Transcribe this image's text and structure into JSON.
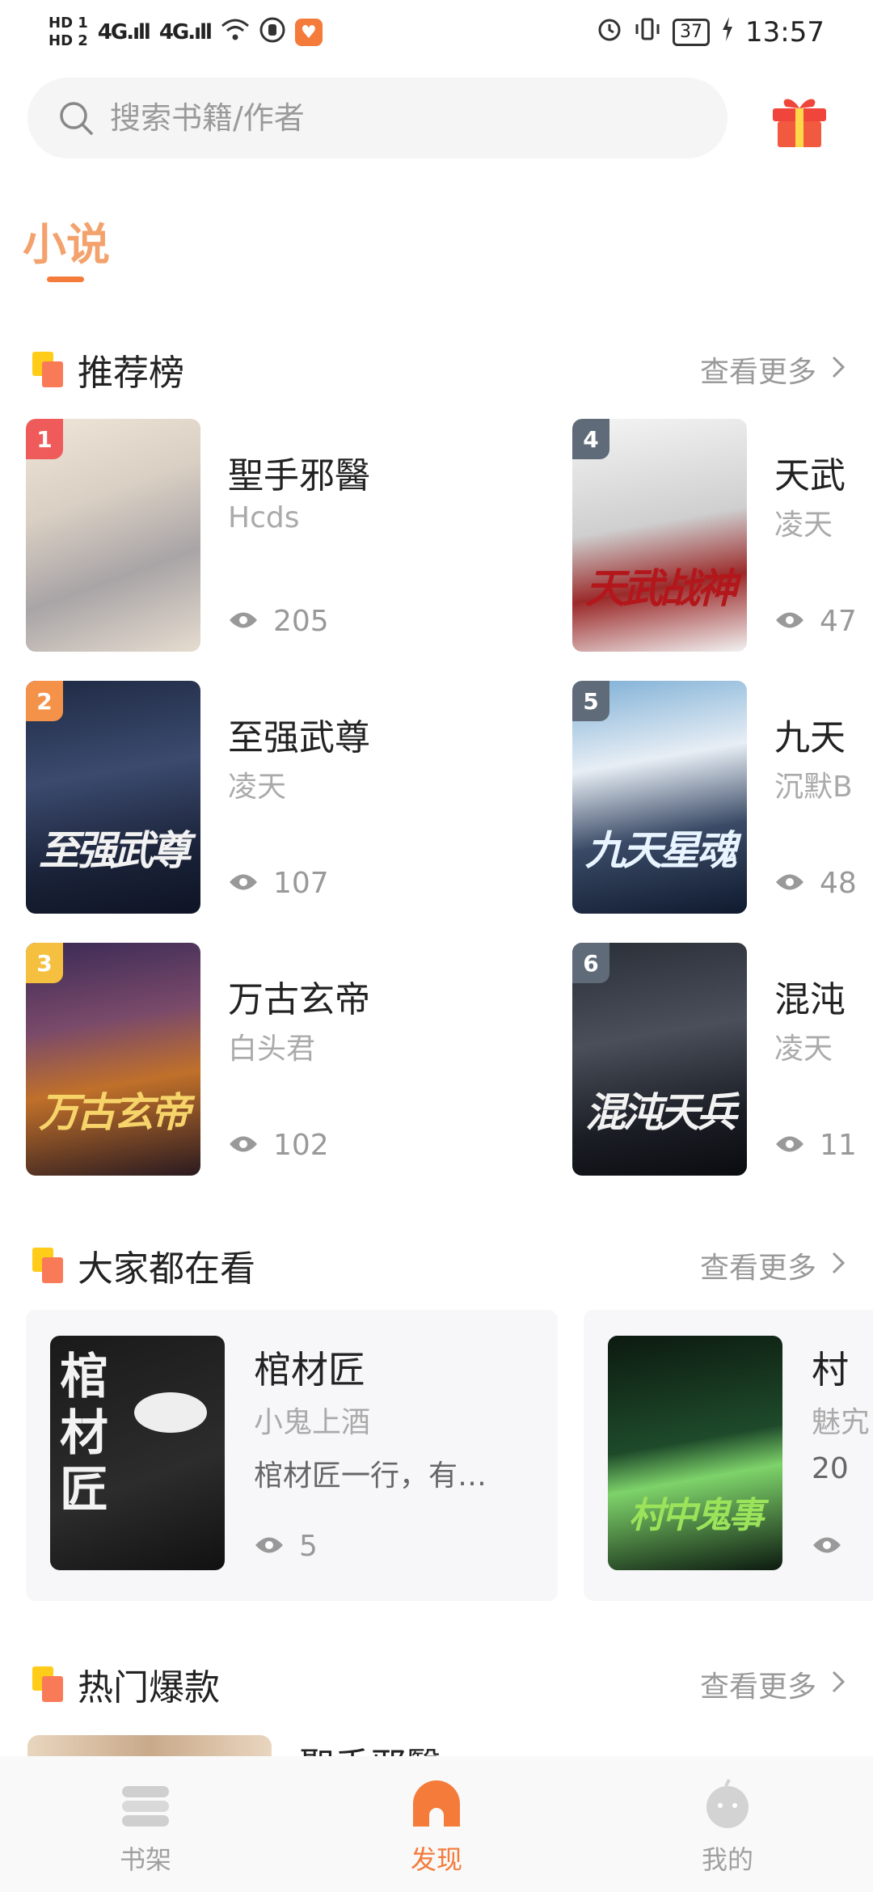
{
  "status_bar": {
    "hd1": "HD 1",
    "hd2": "HD 2",
    "signal1": "4G.ıll",
    "signal2": "4G.ıll",
    "battery": "37",
    "time": "13:57"
  },
  "search": {
    "placeholder": "搜索书籍/作者"
  },
  "category": {
    "active_tab": "小说"
  },
  "sections": {
    "recommend": {
      "title": "推荐榜",
      "more": "查看更多"
    },
    "everyone": {
      "title": "大家都在看",
      "more": "查看更多"
    },
    "hot": {
      "title": "热门爆款",
      "more": "查看更多"
    }
  },
  "ranking": [
    {
      "rank": "1",
      "name": "聖手邪醫",
      "author": "Hcds",
      "views": "205",
      "cover_text": "",
      "badge_color": "#ef5b5b"
    },
    {
      "rank": "2",
      "name": "至强武尊",
      "author": "凌天",
      "views": "107",
      "cover_text": "至强武尊",
      "badge_color": "#f4924a"
    },
    {
      "rank": "3",
      "name": "万古玄帝",
      "author": "白头君",
      "views": "102",
      "cover_text": "万古玄帝",
      "badge_color": "#f5c040"
    },
    {
      "rank": "4",
      "name": "天武",
      "author": "凌天",
      "views": "47",
      "cover_text": "天武战神",
      "badge_color": "#5f6b78"
    },
    {
      "rank": "5",
      "name": "九天",
      "author": "沉默B",
      "views": "48",
      "cover_text": "九天星魂",
      "badge_color": "#5f6b78"
    },
    {
      "rank": "6",
      "name": "混沌",
      "author": "凌天",
      "views": "11",
      "cover_text": "混沌天兵",
      "badge_color": "#5f6b78"
    }
  ],
  "everyone_reading": [
    {
      "name": "棺材匠",
      "author": "小鬼上酒",
      "desc": "棺材匠一行，有…",
      "views": "5",
      "cover_text": "棺材匠"
    },
    {
      "name": "村",
      "author": "魅宄",
      "desc": "20",
      "views": "",
      "cover_text": "村中鬼事"
    }
  ],
  "hot_peek": {
    "title": "聖手邪醫"
  },
  "bottom_nav": [
    {
      "label": "书架",
      "active": false
    },
    {
      "label": "发现",
      "active": true
    },
    {
      "label": "我的",
      "active": false
    }
  ],
  "colors": {
    "accent": "#f47b3a",
    "tab_text": "#f4a26d",
    "gift_red": "#f0453a"
  }
}
